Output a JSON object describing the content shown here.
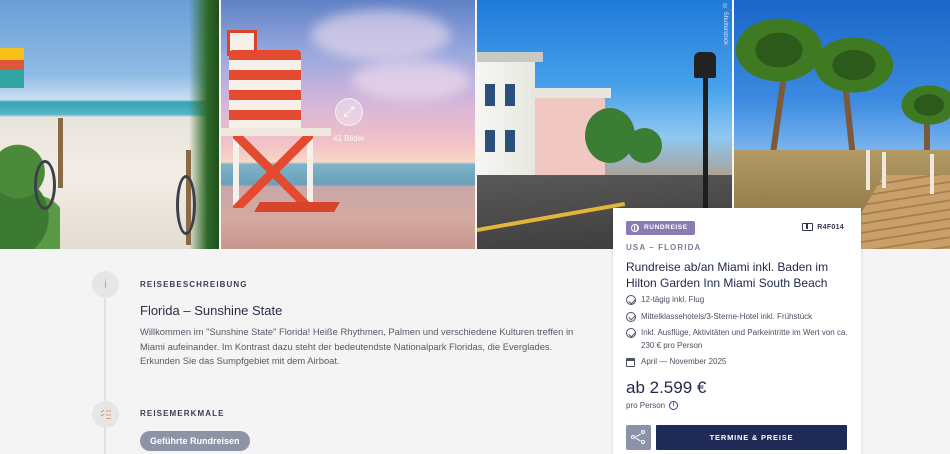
{
  "gallery": {
    "images": [
      {
        "alt": "Miami Beach path with bikes"
      },
      {
        "alt": "Lifeguard tower at sunset"
      },
      {
        "alt": "Key West street"
      },
      {
        "alt": "Palm trees and boardwalk"
      }
    ],
    "image_count_label": "41 Bilder",
    "copyright": "© Shutterstock",
    "expand_icon": "expand-arrows-icon"
  },
  "content": {
    "step1_icon": "info-icon",
    "step1_number": "i",
    "section1_label": "Reisebeschreibung",
    "heading": "Florida – Sunshine State",
    "description": "Willkommen im \"Sunshine State\" Florida! Heiße Rhythmen, Palmen und verschiedene Kulturen treffen in Miami aufeinander. Im Kontrast dazu steht der bedeutendste Nationalpark Floridas, die Everglades. Erkunden Sie das Sumpfgebiet mit dem Airboat.",
    "step2_icon": "list-check-icon",
    "section2_label": "Reisemerkmale",
    "tags": [
      "Geführte Rundreisen"
    ]
  },
  "card": {
    "badge": "Rundreise",
    "code": "R4F014",
    "location": "USA – Florida",
    "title": "Rundreise ab/an Miami inkl. Baden im Hilton Garden Inn Miami South Beach",
    "features": [
      "12-tägig inkl. Flug",
      "Mittelklassehotels/3-Sterne-Hotel inkl. Frühstück",
      "Inkl. Ausflüge, Aktivitäten und Parkeintritte im Wert von ca. 230 € pro Person"
    ],
    "date_range": "April — November 2025",
    "price": "ab 2.599 €",
    "price_note": "pro Person",
    "cta_label": "Termine & Preise",
    "colors": {
      "badge": "#8b7bb3",
      "cta": "#1f2a57",
      "share": "#8c93a8"
    }
  }
}
